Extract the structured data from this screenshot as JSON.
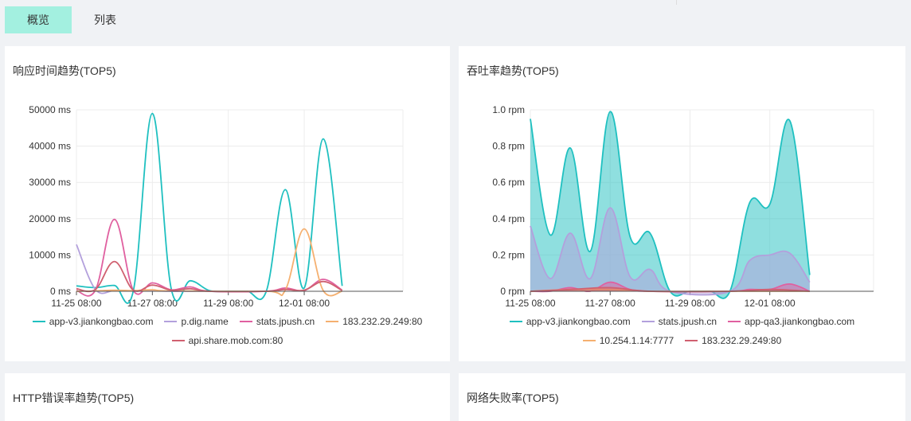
{
  "tabs": [
    {
      "label": "概览",
      "active": true
    },
    {
      "label": "列表",
      "active": false
    }
  ],
  "cards": {
    "response_time": {
      "title": "响应时间趋势(TOP5)"
    },
    "throughput": {
      "title": "吞吐率趋势(TOP5)"
    },
    "http_error": {
      "title": "HTTP错误率趋势(TOP5)"
    },
    "network_fail": {
      "title": "网络失败率(TOP5)"
    }
  },
  "chart_data": [
    {
      "type": "line",
      "title": "响应时间趋势(TOP5)",
      "x_ticks": [
        "11-25 08:00",
        "11-27 08:00",
        "11-29 08:00",
        "12-01 08:00"
      ],
      "x_range": [
        0,
        8.6
      ],
      "y_ticks": [
        "0 ms",
        "10000 ms",
        "20000 ms",
        "30000 ms",
        "40000 ms",
        "50000 ms"
      ],
      "ylim": [
        0,
        50000
      ],
      "grid": true,
      "legend": "bottom",
      "series": [
        {
          "name": "app-v3.jiankongbao.com",
          "color": "#1fc0c0",
          "points": [
            [
              0,
              1500
            ],
            [
              0.5,
              1000
            ],
            [
              1,
              1600
            ],
            [
              1.5,
              200
            ],
            [
              2,
              49000
            ],
            [
              2.5,
              500
            ],
            [
              3,
              2900
            ],
            [
              3.5,
              200
            ],
            [
              4,
              0
            ],
            [
              4.5,
              0
            ],
            [
              5,
              0
            ],
            [
              5.5,
              28000
            ],
            [
              6,
              900
            ],
            [
              6.5,
              42000
            ],
            [
              7,
              1500
            ]
          ]
        },
        {
          "name": "p.dig.name",
          "color": "#b3a0dc",
          "points": [
            [
              0,
              12900
            ],
            [
              0.5,
              500
            ],
            [
              1,
              200
            ],
            [
              1.5,
              100
            ],
            [
              2,
              100
            ],
            [
              2.5,
              0
            ],
            [
              3,
              0
            ],
            [
              3.5,
              0
            ]
          ]
        },
        {
          "name": "stats.jpush.cn",
          "color": "#e060a0",
          "points": [
            [
              0,
              200
            ],
            [
              0.5,
              300
            ],
            [
              1,
              19800
            ],
            [
              1.5,
              200
            ],
            [
              2,
              2300
            ],
            [
              2.5,
              400
            ],
            [
              3,
              1200
            ],
            [
              3.5,
              0
            ],
            [
              5,
              0
            ],
            [
              5.5,
              900
            ],
            [
              6,
              200
            ],
            [
              6.5,
              3300
            ],
            [
              7,
              300
            ]
          ]
        },
        {
          "name": "183.232.29.249:80",
          "color": "#f5b070",
          "points": [
            [
              0,
              0
            ],
            [
              0.5,
              100
            ],
            [
              1,
              300
            ],
            [
              1.5,
              200
            ],
            [
              2,
              400
            ],
            [
              2.5,
              100
            ],
            [
              5,
              0
            ],
            [
              5.5,
              300
            ],
            [
              6,
              17200
            ],
            [
              6.5,
              200
            ],
            [
              7,
              0
            ]
          ]
        },
        {
          "name": "api.share.mob.com:80",
          "color": "#d06070",
          "points": [
            [
              0,
              700
            ],
            [
              0.5,
              500
            ],
            [
              1,
              8200
            ],
            [
              1.5,
              300
            ],
            [
              2,
              1700
            ],
            [
              2.5,
              300
            ],
            [
              3,
              700
            ],
            [
              3.5,
              0
            ],
            [
              5,
              0
            ],
            [
              5.5,
              500
            ],
            [
              6,
              300
            ],
            [
              6.5,
              2700
            ],
            [
              7,
              200
            ]
          ]
        }
      ]
    },
    {
      "type": "area",
      "title": "吞吐率趋势(TOP5)",
      "x_ticks": [
        "11-25 08:00",
        "11-27 08:00",
        "11-29 08:00",
        "12-01 08:00"
      ],
      "x_range": [
        0,
        8.6
      ],
      "y_ticks": [
        "0 rpm",
        "0.2 rpm",
        "0.4 rpm",
        "0.6 rpm",
        "0.8 rpm",
        "1.0 rpm"
      ],
      "ylim": [
        0,
        1.0
      ],
      "grid": true,
      "legend": "bottom",
      "series": [
        {
          "name": "app-v3.jiankongbao.com",
          "color": "#1fc0c0",
          "points": [
            [
              0,
              0.95
            ],
            [
              0.5,
              0.31
            ],
            [
              1,
              0.79
            ],
            [
              1.5,
              0.22
            ],
            [
              2,
              0.99
            ],
            [
              2.5,
              0.3
            ],
            [
              3,
              0.32
            ],
            [
              3.5,
              0
            ],
            [
              4,
              0
            ],
            [
              4.5,
              0
            ],
            [
              5,
              0
            ],
            [
              5.5,
              0.49
            ],
            [
              6,
              0.48
            ],
            [
              6.5,
              0.94
            ],
            [
              7,
              0.09
            ]
          ]
        },
        {
          "name": "stats.jpush.cn",
          "color": "#b3a0dc",
          "points": [
            [
              0,
              0.36
            ],
            [
              0.5,
              0.07
            ],
            [
              1,
              0.32
            ],
            [
              1.5,
              0.07
            ],
            [
              2,
              0.46
            ],
            [
              2.5,
              0.08
            ],
            [
              3,
              0.12
            ],
            [
              3.5,
              0
            ],
            [
              5,
              0
            ],
            [
              5.5,
              0.17
            ],
            [
              6,
              0.2
            ],
            [
              6.5,
              0.21
            ],
            [
              7,
              0.05
            ]
          ]
        },
        {
          "name": "app-qa3.jiankongbao.com",
          "color": "#e060a0",
          "points": [
            [
              0,
              0
            ],
            [
              0.5,
              0
            ],
            [
              1,
              0.02
            ],
            [
              1.5,
              0
            ],
            [
              2,
              0.05
            ],
            [
              2.5,
              0.01
            ],
            [
              3,
              0
            ],
            [
              5,
              0
            ],
            [
              5.5,
              0.01
            ],
            [
              6,
              0.01
            ],
            [
              6.5,
              0.04
            ],
            [
              7,
              0
            ]
          ]
        },
        {
          "name": "10.254.1.14:7777",
          "color": "#f5b070",
          "points": [
            [
              0,
              0
            ],
            [
              1,
              0.01
            ],
            [
              2,
              0.01
            ],
            [
              3,
              0
            ],
            [
              5,
              0
            ],
            [
              6,
              0
            ],
            [
              7,
              0
            ]
          ]
        },
        {
          "name": "183.232.29.249:80",
          "color": "#d06070",
          "points": [
            [
              0,
              0
            ],
            [
              1,
              0.01
            ],
            [
              2,
              0.02
            ],
            [
              3,
              0
            ],
            [
              5,
              0
            ],
            [
              6,
              0.01
            ],
            [
              7,
              0
            ]
          ]
        }
      ]
    }
  ]
}
